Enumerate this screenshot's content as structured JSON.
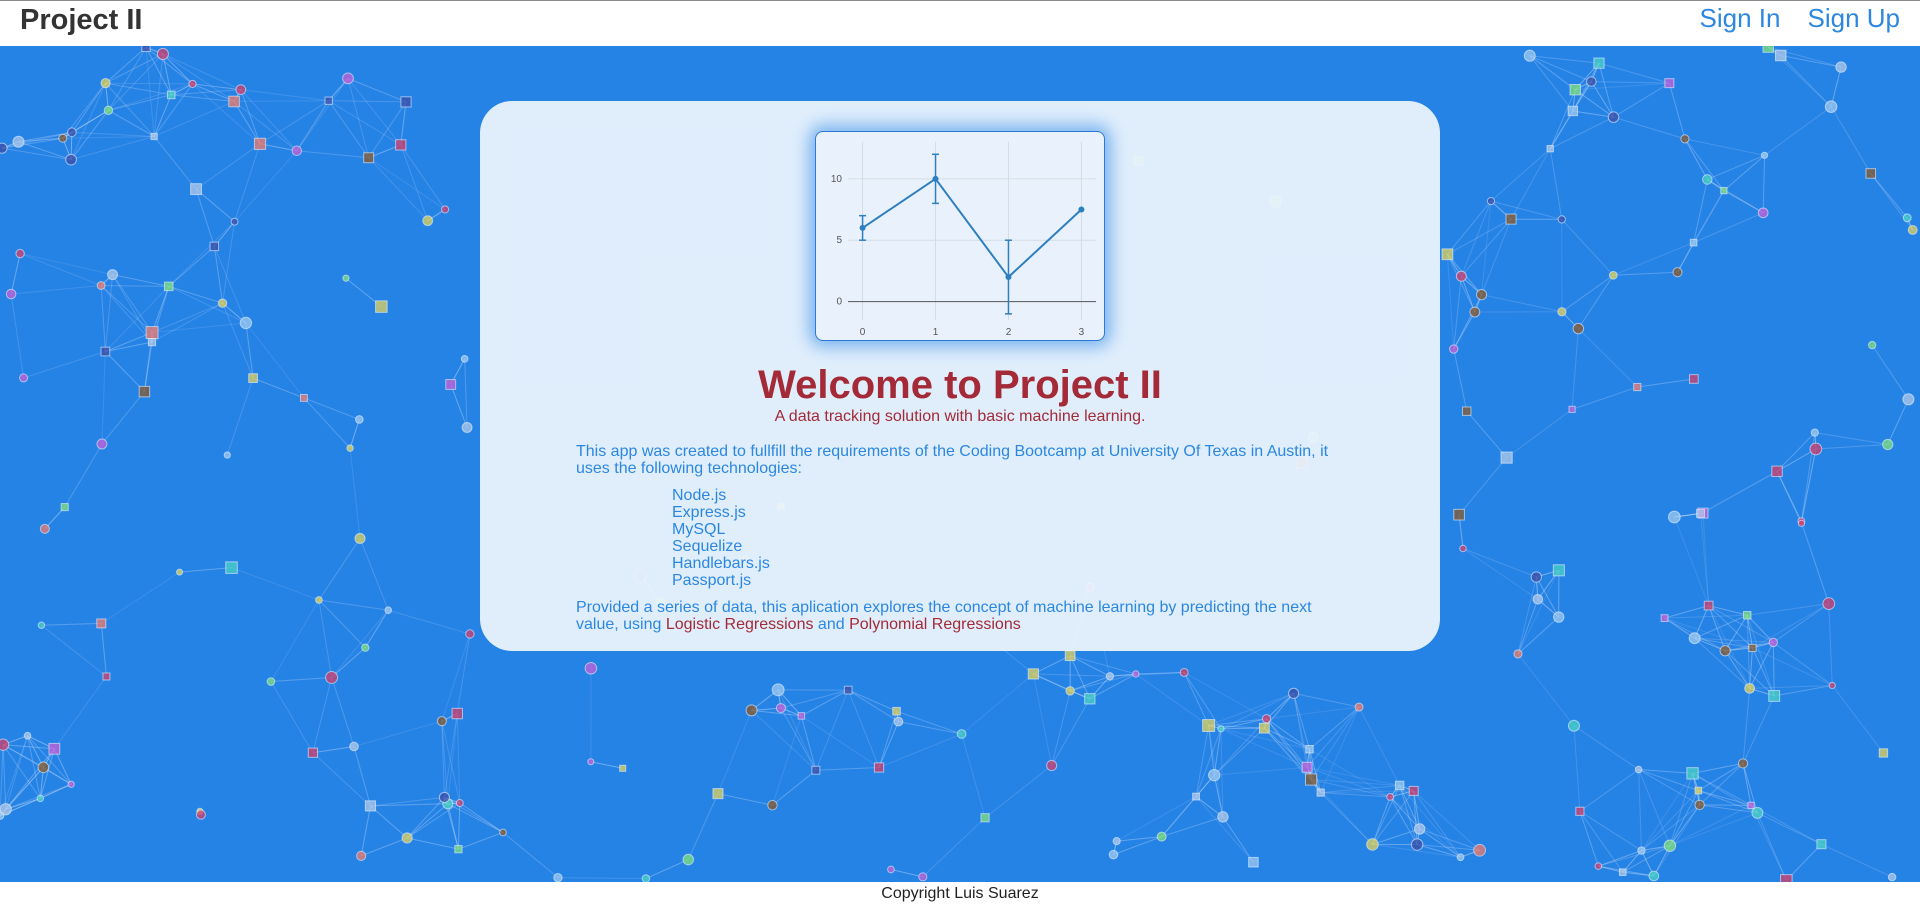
{
  "header": {
    "brand": "Project II",
    "sign_in": "Sign In",
    "sign_up": "Sign Up"
  },
  "hero": {
    "title": "Welcome to Project II",
    "subtitle": "A data tracking solution with basic machine learning.",
    "intro": "This app was created to fullfill the requirements of the Coding Bootcamp at University Of Texas in Austin, it uses the following technologies:",
    "technologies": [
      "Node.js",
      "Express.js",
      "MySQL",
      "Sequelize",
      "Handlebars.js",
      "Passport.js"
    ],
    "outro_before": "Provided a series of data, this aplication explores the concept of machine learning by predicting the next value, using",
    "logistic": "Logistic Regressions",
    "conjunction": "and",
    "polynomial": "Polynomial Regressions"
  },
  "footer": {
    "copyright": "Copyright Luis Suarez"
  },
  "colors": {
    "background_blue": "#2683e6",
    "accent_red": "#a32a36",
    "link_blue": "#2b87e0",
    "line_blue": "#2e7fbf"
  },
  "chart_data": {
    "type": "line",
    "x": [
      0,
      1,
      2,
      3
    ],
    "y": [
      6,
      10,
      2,
      7.5
    ],
    "error_plus": [
      1,
      2,
      3,
      0
    ],
    "error_minus": [
      1,
      2,
      3,
      0
    ],
    "x_ticks": [
      0,
      1,
      2,
      3
    ],
    "y_ticks": [
      0,
      5,
      10
    ],
    "xlim": [
      -0.2,
      3.2
    ],
    "ylim": [
      -1.5,
      13
    ],
    "grid": true
  }
}
